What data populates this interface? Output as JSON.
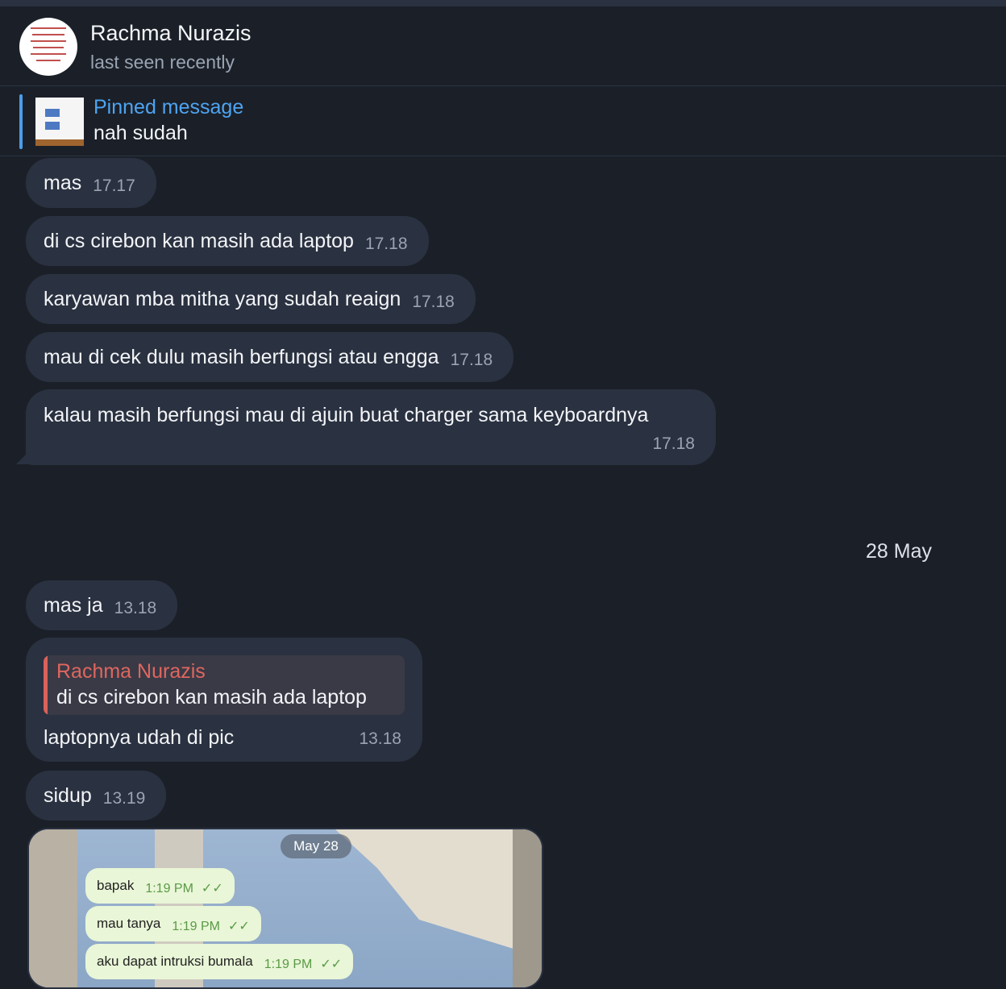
{
  "header": {
    "contact_name": "Rachma Nurazis",
    "status": "last seen recently"
  },
  "pinned": {
    "title": "Pinned message",
    "text": "nah sudah"
  },
  "messages": [
    {
      "text": "mas",
      "time": "17.17"
    },
    {
      "text": "di cs cirebon kan masih ada laptop",
      "time": "17.18"
    },
    {
      "text": "karyawan mba mitha yang sudah reaign",
      "time": "17.18"
    },
    {
      "text": "mau di cek dulu masih berfungsi atau engga",
      "time": "17.18"
    },
    {
      "text": "kalau masih berfungsi mau di ajuin buat charger sama keyboardnya",
      "time": "17.18"
    }
  ],
  "date_separator": "28 May",
  "messages_day2": [
    {
      "text": "mas ja",
      "time": "13.18"
    }
  ],
  "reply_message": {
    "quote_name": "Rachma Nurazis",
    "quote_text": "di cs cirebon kan masih ada laptop",
    "text": "laptopnya udah di pic",
    "time": "13.18"
  },
  "message_sidup": {
    "text": "sidup",
    "time": "13.19"
  },
  "photo": {
    "date_pill": "May 28",
    "bubbles": [
      {
        "text": "bapak",
        "time": "1:19 PM"
      },
      {
        "text": "mau tanya",
        "time": "1:19 PM"
      },
      {
        "text": "aku dapat intruksi bumala",
        "time": "1:19 PM"
      }
    ],
    "check_icon": "✓✓"
  }
}
